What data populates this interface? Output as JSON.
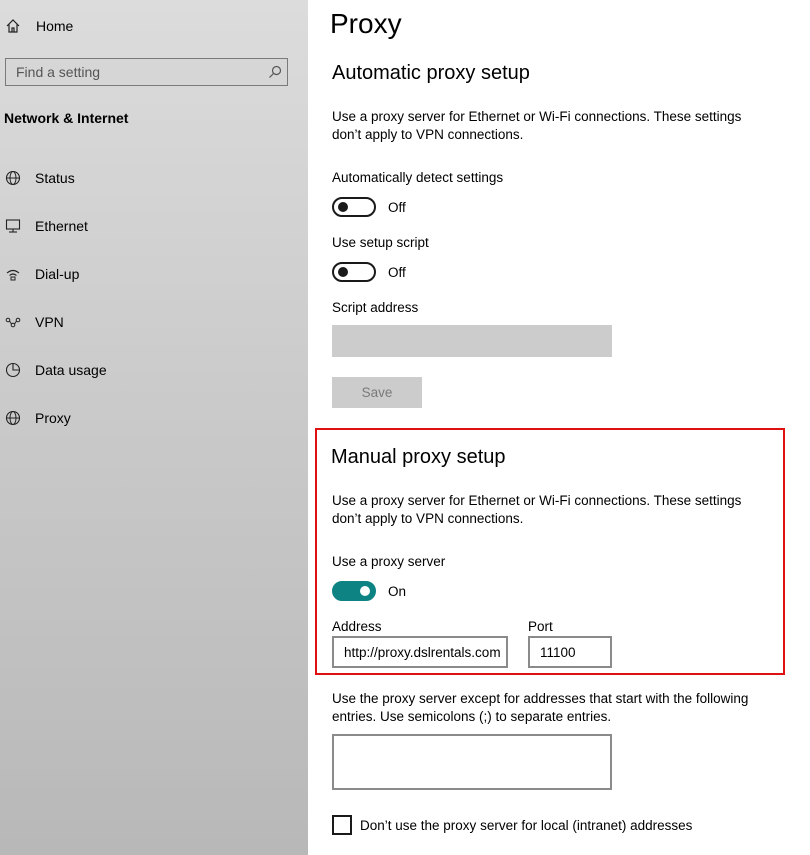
{
  "sidebar": {
    "home_label": "Home",
    "search_placeholder": "Find a setting",
    "section_title": "Network & Internet",
    "items": [
      {
        "label": "Status",
        "icon": "globe-status-icon"
      },
      {
        "label": "Ethernet",
        "icon": "ethernet-icon"
      },
      {
        "label": "Dial-up",
        "icon": "dial-up-icon"
      },
      {
        "label": "VPN",
        "icon": "vpn-icon"
      },
      {
        "label": "Data usage",
        "icon": "data-usage-icon"
      },
      {
        "label": "Proxy",
        "icon": "globe-icon"
      }
    ]
  },
  "main": {
    "title": "Proxy",
    "automatic": {
      "heading": "Automatic proxy setup",
      "description": "Use a proxy server for Ethernet or Wi-Fi connections. These settings don’t apply to VPN connections.",
      "detect_label": "Automatically detect settings",
      "detect_state": "Off",
      "script_label": "Use setup script",
      "script_state": "Off",
      "address_label": "Script address",
      "save_label": "Save"
    },
    "manual": {
      "heading": "Manual proxy setup",
      "description": "Use a proxy server for Ethernet or Wi-Fi connections. These settings don’t apply to VPN connections.",
      "use_proxy_label": "Use a proxy server",
      "use_proxy_state": "On",
      "address_label": "Address",
      "address_value": "http://proxy.dslrentals.com",
      "port_label": "Port",
      "port_value": "11100"
    },
    "exceptions_description": "Use the proxy server except for addresses that start with the following entries. Use semicolons (;) to separate entries.",
    "exceptions_value": "",
    "local_checkbox_label": "Don’t use the proxy server for local (intranet) addresses"
  },
  "colors": {
    "toggle_on": "#0e8383",
    "highlight_border": "#e01010"
  }
}
